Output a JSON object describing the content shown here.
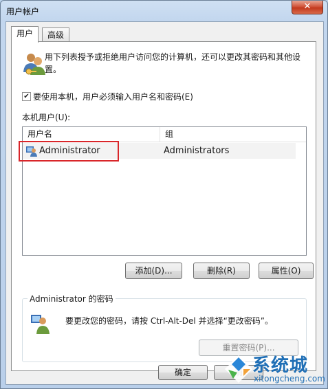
{
  "window": {
    "title": "用户帐户",
    "close_symbol": "✕"
  },
  "tabs": [
    {
      "label": "用户",
      "active": true
    },
    {
      "label": "高级",
      "active": false
    }
  ],
  "users_tab": {
    "description": "用下列表授予或拒绝用户访问您的计算机，还可以更改其密码和其他设置。",
    "require_login": {
      "label": "要使用本机，用户必须输入用户名和密码(E)",
      "checked": true
    },
    "list_label": "本机用户(U):",
    "columns": [
      "用户名",
      "组"
    ],
    "rows": [
      {
        "username": "Administrator",
        "group": "Administrators",
        "selected": true
      }
    ],
    "buttons": {
      "add": "添加(D)...",
      "remove": "删除(R)",
      "properties": "属性(O)"
    },
    "password_group": {
      "title": "Administrator 的密码",
      "text": "要更改您的密码，请按 Ctrl-Alt-Del 并选择“更改密码”。",
      "reset_button": "重置密码(P)..."
    }
  },
  "footer": {
    "ok": "确定",
    "cancel": "消"
  },
  "watermark": {
    "brand": "系统城",
    "url": "xitongcheng.com"
  },
  "colors": {
    "highlight_box": "#d9262a",
    "brand_blue": "#1f6fb6"
  }
}
